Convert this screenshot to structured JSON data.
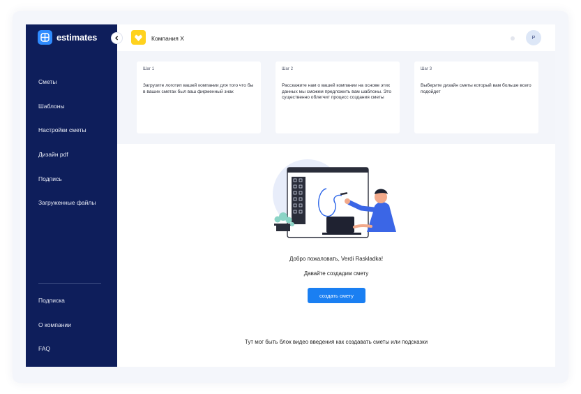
{
  "app": {
    "brand": "estimates",
    "brand_color": "#2f8cff",
    "sidebar_bg": "#0e1e5b"
  },
  "sidebar": {
    "items": [
      {
        "label": "Сметы",
        "icon": null
      },
      {
        "label": "Шаблоны",
        "icon": null
      },
      {
        "label": "Настройки сметы",
        "icon": null
      },
      {
        "label": "Дизайн pdf",
        "icon": null
      },
      {
        "label": "Подпись",
        "icon": null
      },
      {
        "label": "Загруженные файлы",
        "icon": null
      }
    ],
    "bottom_items": [
      {
        "label": "Подписка"
      },
      {
        "label": "О компании"
      },
      {
        "label": "FAQ"
      }
    ],
    "collapse_icon": "chevron-left-icon"
  },
  "header": {
    "company_name": "Компания Х",
    "company_logo_color": "#ffd21e",
    "avatar_initial": "P"
  },
  "steps": [
    {
      "number": "Шаг 1",
      "text": "Загрузите логотип вашей компании для того что бы в ваших сметах был ваш фирменный знак"
    },
    {
      "number": "Шаг 2",
      "text": "Расскажите нам о вашей компании на основе этих данных мы сможем предложить вам шаблоны. Это существенно облегчит процесс создания сметы"
    },
    {
      "number": "Шаг 3",
      "text": "Выберите дизайн сметы который вам больше всего подойдет"
    }
  ],
  "main": {
    "welcome": "Добро пожаловать, Verdi Raskladka!",
    "subtitle": "Давайте создадим смету",
    "cta_label": "создать смету",
    "cta_color": "#1a7ff2",
    "footer_note": "Тут мог быть блок видео введения как создавать сметы или подсказки"
  }
}
